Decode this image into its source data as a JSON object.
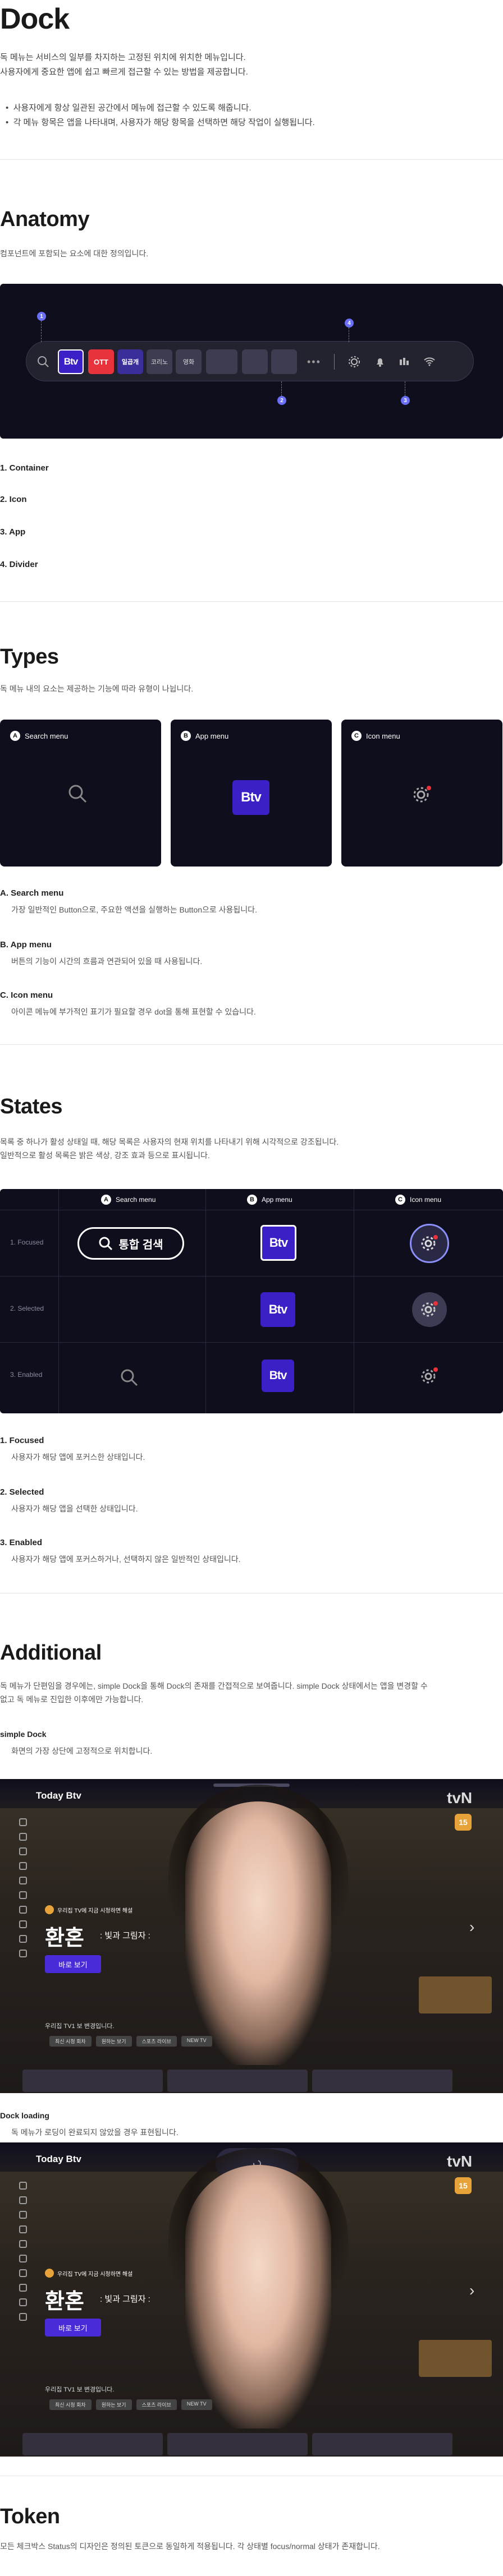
{
  "title": "Dock",
  "intro": {
    "line1": "독 메뉴는 서비스의 일부를 차지하는 고정된 위치에 위치한 메뉴입니다.",
    "line2": "사용자에게 중요한 앱에 쉽고 빠르게 접근할 수 있는 방법을 제공합니다.",
    "bullet1": "사용자에게 항상 일관된 공간에서 메뉴에 접근할 수 있도록 해줍니다.",
    "bullet2": "각 메뉴 항목은 앱을 나타내며, 사용자가 해당 항목을 선택하면 해당 작업이 실행됩니다."
  },
  "anatomy": {
    "title": "Anatomy",
    "desc": "컴포넌트에 포함되는 요소에 대한 정의입니다.",
    "markers": [
      "1",
      "2",
      "3",
      "4"
    ],
    "dock_apps": [
      "Btv",
      "OTT",
      "일곱개",
      "코리노",
      "영화"
    ],
    "parts": [
      "1. Container",
      "2. Icon",
      "3. App",
      "4. Divider"
    ]
  },
  "types": {
    "title": "Types",
    "desc": "독 메뉴 내의 요소는 제공하는 기능에 따라 유형이 나뉩니다.",
    "cards": [
      {
        "badge": "A",
        "label": "Search menu"
      },
      {
        "badge": "B",
        "label": "App menu"
      },
      {
        "badge": "C",
        "label": "Icon menu"
      }
    ],
    "items": [
      {
        "label": "A. Search menu",
        "desc": "가장 일반적인 Button으로, 주요한 액션을 실행하는 Button으로 사용됩니다."
      },
      {
        "label": "B. App menu",
        "desc": "버튼의 기능이 시간의 흐름과 연관되어 있을 때 사용됩니다."
      },
      {
        "label": "C. Icon menu",
        "desc": "아이콘 메뉴에 부가적인 표기가 필요할 경우 dot을 통해 표현할 수 있습니다."
      }
    ]
  },
  "states": {
    "title": "States",
    "desc1": "목록 중 하나가 활성 상태일 때, 해당 목록은 사용자의 현재 위치를 나타내기 위해 시각적으로 강조됩니다.",
    "desc2": "일반적으로 활성 목록은 밝은 색상, 강조 효과 등으로 표시됩니다.",
    "columns": [
      {
        "badge": "A",
        "label": "Search menu"
      },
      {
        "badge": "B",
        "label": "App menu"
      },
      {
        "badge": "C",
        "label": "Icon menu"
      }
    ],
    "rows": [
      "1. Focused",
      "2. Selected",
      "3. Enabled"
    ],
    "search_focused_label": "통합 검색",
    "items": [
      {
        "label": "1. Focused",
        "desc": "사용자가 해당 앱에 포커스한 상태입니다."
      },
      {
        "label": "2. Selected",
        "desc": "사용자가 해당 앱을 선택한 상태입니다."
      },
      {
        "label": "3. Enabled",
        "desc": "사용자가 해당 앱에 포커스하거나, 선택하지 않은 일반적인 상태입니다."
      }
    ]
  },
  "additional": {
    "title": "Additional",
    "desc1": "독 메뉴가 단편임을 경우에는, simple Dock을 통해 Dock의 존재를 간접적으로 보여줍니다. simple Dock 상태에서는 앱을 변경할 수",
    "desc2": "없고 독 메뉴로 진입한 이후에만 가능합니다.",
    "simple": {
      "label": "simple Dock",
      "desc": "화면의 가장 상단에 고정적으로 위치합니다."
    },
    "loading": {
      "label": "Dock loading",
      "desc": "독 메뉴가 로딩이 완료되지 않았을 경우 표현됩니다."
    },
    "screen": {
      "logo": "Today Btv",
      "brand": "tvN",
      "rating": "15",
      "badge_text": "우리집 TV에 지금 시청하면 해설",
      "show_title": "환혼",
      "show_sub": "빛과 그림자",
      "watch_button": "바로 보기",
      "caption": "우리집 TV1 보 변경입니다.",
      "tags": [
        "최신 시청 회차",
        "원하는 보기",
        "스포츠 라이브",
        "NEW TV"
      ]
    }
  },
  "token": {
    "title": "Token",
    "desc": "모든 체크박스 Status의 디자인은 정의된 토큰으로 동일하게 적용됩니다. 각 상태별 focus/normal 상태가 존재합니다."
  },
  "colors": {
    "accent": "#3b1fc7",
    "marker": "#6b6ff7",
    "dark": "#0f0e1c",
    "red": "#e8333c"
  }
}
